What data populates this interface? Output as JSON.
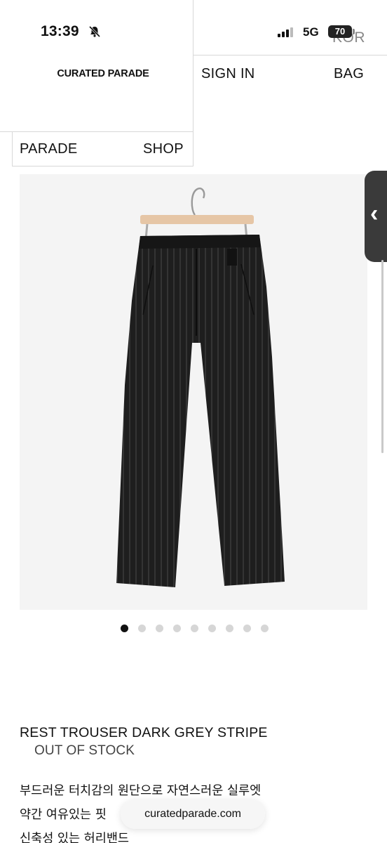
{
  "status_bar": {
    "time": "13:39",
    "network": "5G",
    "battery": "70"
  },
  "header": {
    "brand": "CURATED PARADE",
    "language": "KOR",
    "sign_in": "SIGN IN",
    "bag": "BAG",
    "parade": "PARADE",
    "shop": "SHOP"
  },
  "gallery": {
    "total_images": 9,
    "active_index": 0
  },
  "product": {
    "name": "REST TROUSER DARK GREY STRIPE",
    "stock_status": "OUT OF STOCK",
    "description": [
      "부드러운 터치감의 원단으로 자연스러운 실루엣",
      "약간 여유있는 핏",
      "신축성 있는 허리밴드"
    ]
  },
  "browser": {
    "url": "curatedparade.com"
  },
  "colors": {
    "background": "#ffffff",
    "text": "#111111",
    "divider": "#d8d8d8",
    "active_dot": "#111111",
    "inactive_dot": "#d6d6d6"
  }
}
